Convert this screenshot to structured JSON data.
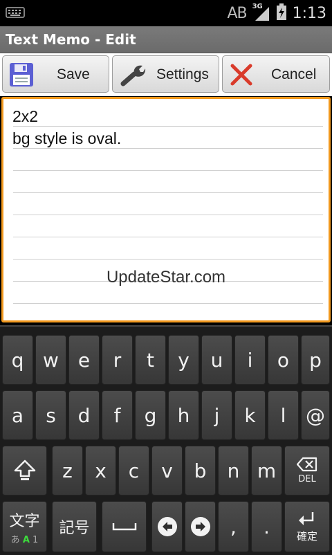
{
  "status_bar": {
    "ab_label": "AB",
    "network": "3G",
    "time": "1:13"
  },
  "title": "Text Memo - Edit",
  "toolbar": {
    "save": "Save",
    "settings": "Settings",
    "cancel": "Cancel"
  },
  "memo": {
    "lines": [
      "2x2",
      "bg style is oval."
    ],
    "watermark": "UpdateStar.com"
  },
  "keyboard": {
    "row1": [
      "q",
      "w",
      "e",
      "r",
      "t",
      "y",
      "u",
      "i",
      "o",
      "p"
    ],
    "row2": [
      "a",
      "s",
      "d",
      "f",
      "g",
      "h",
      "j",
      "k",
      "l",
      "@"
    ],
    "row3": [
      "z",
      "x",
      "c",
      "v",
      "b",
      "n",
      "m"
    ],
    "del_label": "DEL",
    "mode_label": "文字",
    "mode_sub": [
      "あ",
      "A",
      "1"
    ],
    "symbol_label": "記号",
    "comma": ",",
    "period": ".",
    "enter_label": "確定"
  },
  "colors": {
    "accent": "#f39a1e",
    "save_icon": "#5b5fd3",
    "cancel_icon": "#d93b2b",
    "mode_active": "#3ddc3d"
  }
}
